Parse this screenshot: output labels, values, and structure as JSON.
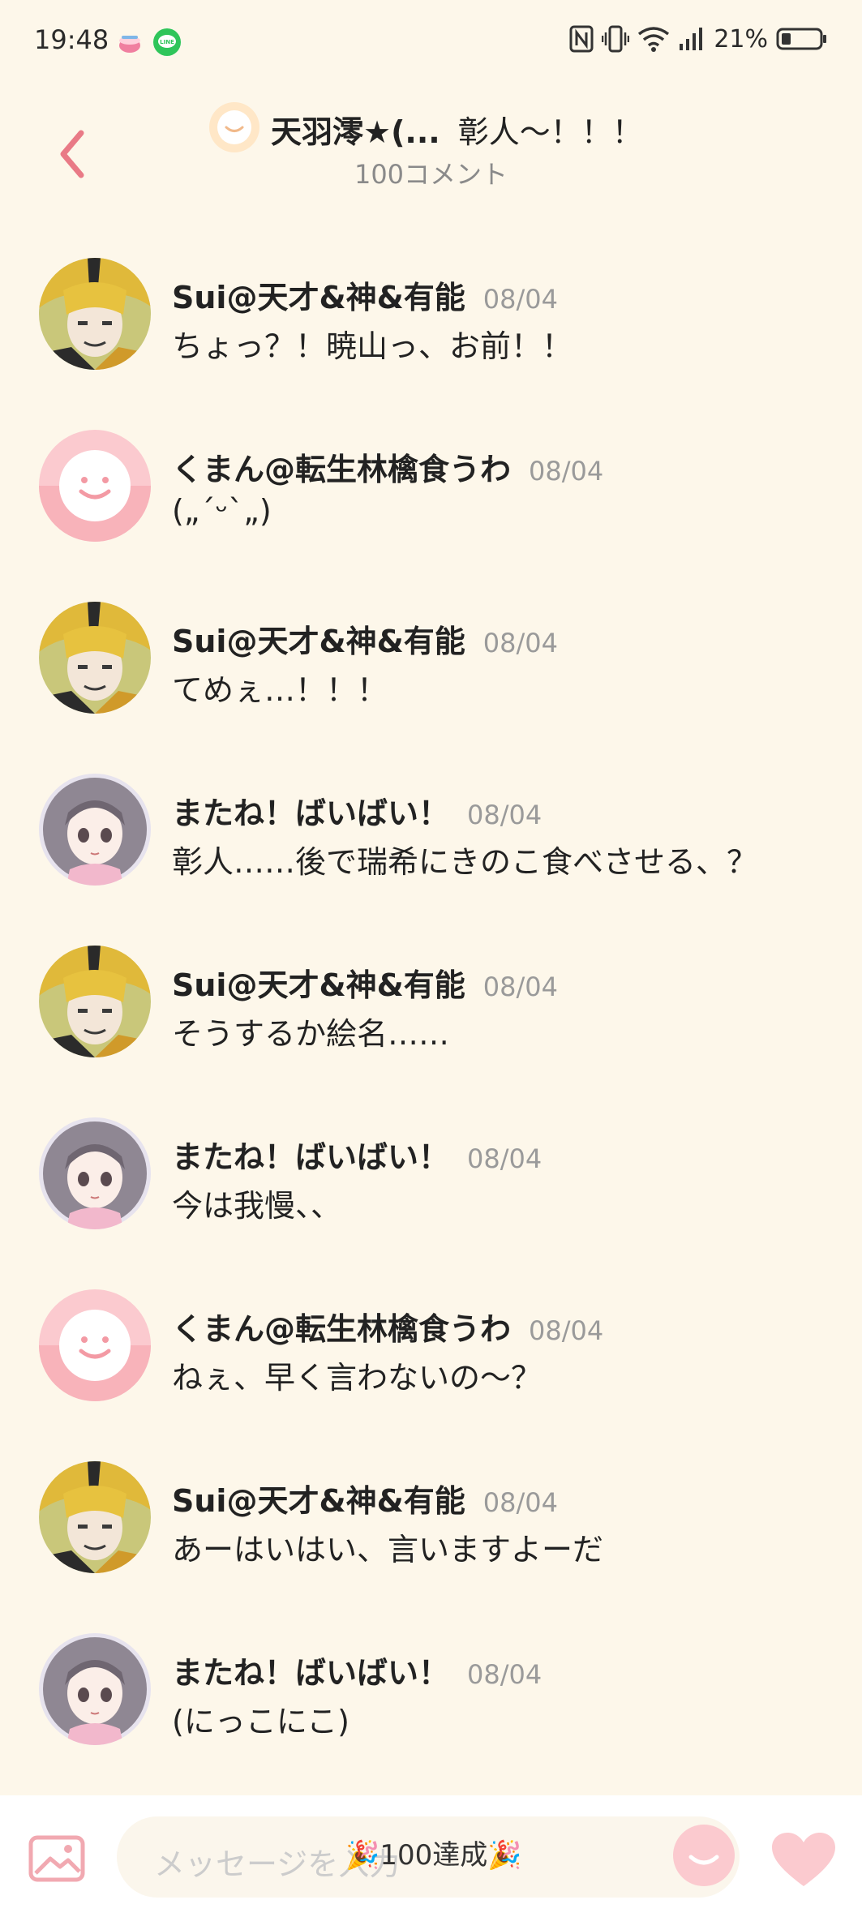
{
  "status": {
    "time": "19:48",
    "battery": "21%"
  },
  "header": {
    "title": "天羽澪★(...",
    "subtitle": "彰人〜！！！",
    "comment_count": "100コメント"
  },
  "messages": [
    {
      "name": "Sui@天才&神&有能",
      "date": "08/04",
      "text": "ちょっ？！暁山っ、お前！！",
      "avatar": "sui"
    },
    {
      "name": "くまん@転生林檎食うわ",
      "date": "08/04",
      "text": "(„´ᵕ`„)",
      "avatar": "default"
    },
    {
      "name": "Sui@天才&神&有能",
      "date": "08/04",
      "text": "てめぇ…！！！",
      "avatar": "sui"
    },
    {
      "name": "またね！ばいばい！",
      "date": "08/04",
      "text": "彰人……後で瑞希にきのこ食べさせる、？",
      "avatar": "girl"
    },
    {
      "name": "Sui@天才&神&有能",
      "date": "08/04",
      "text": "そうするか絵名……",
      "avatar": "sui"
    },
    {
      "name": "またね！ばいばい！",
      "date": "08/04",
      "text": "今は我慢、、",
      "avatar": "girl"
    },
    {
      "name": "くまん@転生林檎食うわ",
      "date": "08/04",
      "text": "ねぇ、早く言わないの〜？",
      "avatar": "default"
    },
    {
      "name": "Sui@天才&神&有能",
      "date": "08/04",
      "text": "あーはいはい、言いますよーだ",
      "avatar": "sui"
    },
    {
      "name": "またね！ばいばい！",
      "date": "08/04",
      "text": "(にっこにこ)",
      "avatar": "girl"
    }
  ],
  "input": {
    "placeholder": "メッセージを入力",
    "badge": "🎉100達成🎉"
  },
  "colors": {
    "background": "#fdf7ea",
    "accent": "#e97a86",
    "pink_light": "#fbcacf"
  }
}
